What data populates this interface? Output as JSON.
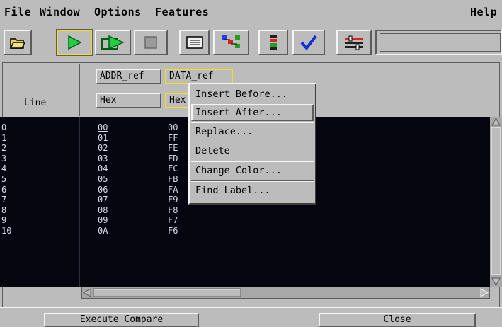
{
  "menubar": {
    "items": [
      "File",
      "Window",
      "Options",
      "Features"
    ],
    "help": "Help"
  },
  "toolbar": {
    "buttons": [
      {
        "name": "open-folder-icon"
      },
      {
        "name": "run-icon"
      },
      {
        "name": "run-repetitive-icon"
      },
      {
        "name": "stop-icon"
      },
      {
        "name": "list-icon"
      },
      {
        "name": "network-icon"
      },
      {
        "name": "chip-icon"
      },
      {
        "name": "check-icon"
      },
      {
        "name": "settings-icon"
      }
    ],
    "input_value": ""
  },
  "table": {
    "line_header": "Line",
    "columns": [
      {
        "label": "ADDR_ref",
        "base": "Hex"
      },
      {
        "label": "DATA_ref",
        "base": "Hex"
      }
    ],
    "rows": [
      {
        "line": "0",
        "addr": "00",
        "data": "00"
      },
      {
        "line": "1",
        "addr": "01",
        "data": "FF"
      },
      {
        "line": "2",
        "addr": "02",
        "data": "FE"
      },
      {
        "line": "3",
        "addr": "03",
        "data": "FD"
      },
      {
        "line": "4",
        "addr": "04",
        "data": "FC"
      },
      {
        "line": "5",
        "addr": "05",
        "data": "FB"
      },
      {
        "line": "6",
        "addr": "06",
        "data": "FA"
      },
      {
        "line": "7",
        "addr": "07",
        "data": "F9"
      },
      {
        "line": "8",
        "addr": "08",
        "data": "F8"
      },
      {
        "line": "9",
        "addr": "09",
        "data": "F7"
      },
      {
        "line": "10",
        "addr": "0A",
        "data": "F6"
      }
    ]
  },
  "context_menu": {
    "items": [
      "Insert Before...",
      "Insert After...",
      "Replace...",
      "Delete",
      "Change Color...",
      "Find Label..."
    ],
    "highlighted": "Insert After..."
  },
  "bottom": {
    "execute_label": "Execute Compare",
    "close_label": "Close"
  },
  "colors": {
    "background": "#bcbcbc",
    "data_bg": "#050510",
    "data_text": "#d8d8e8",
    "selection_border": "#f0e020"
  }
}
